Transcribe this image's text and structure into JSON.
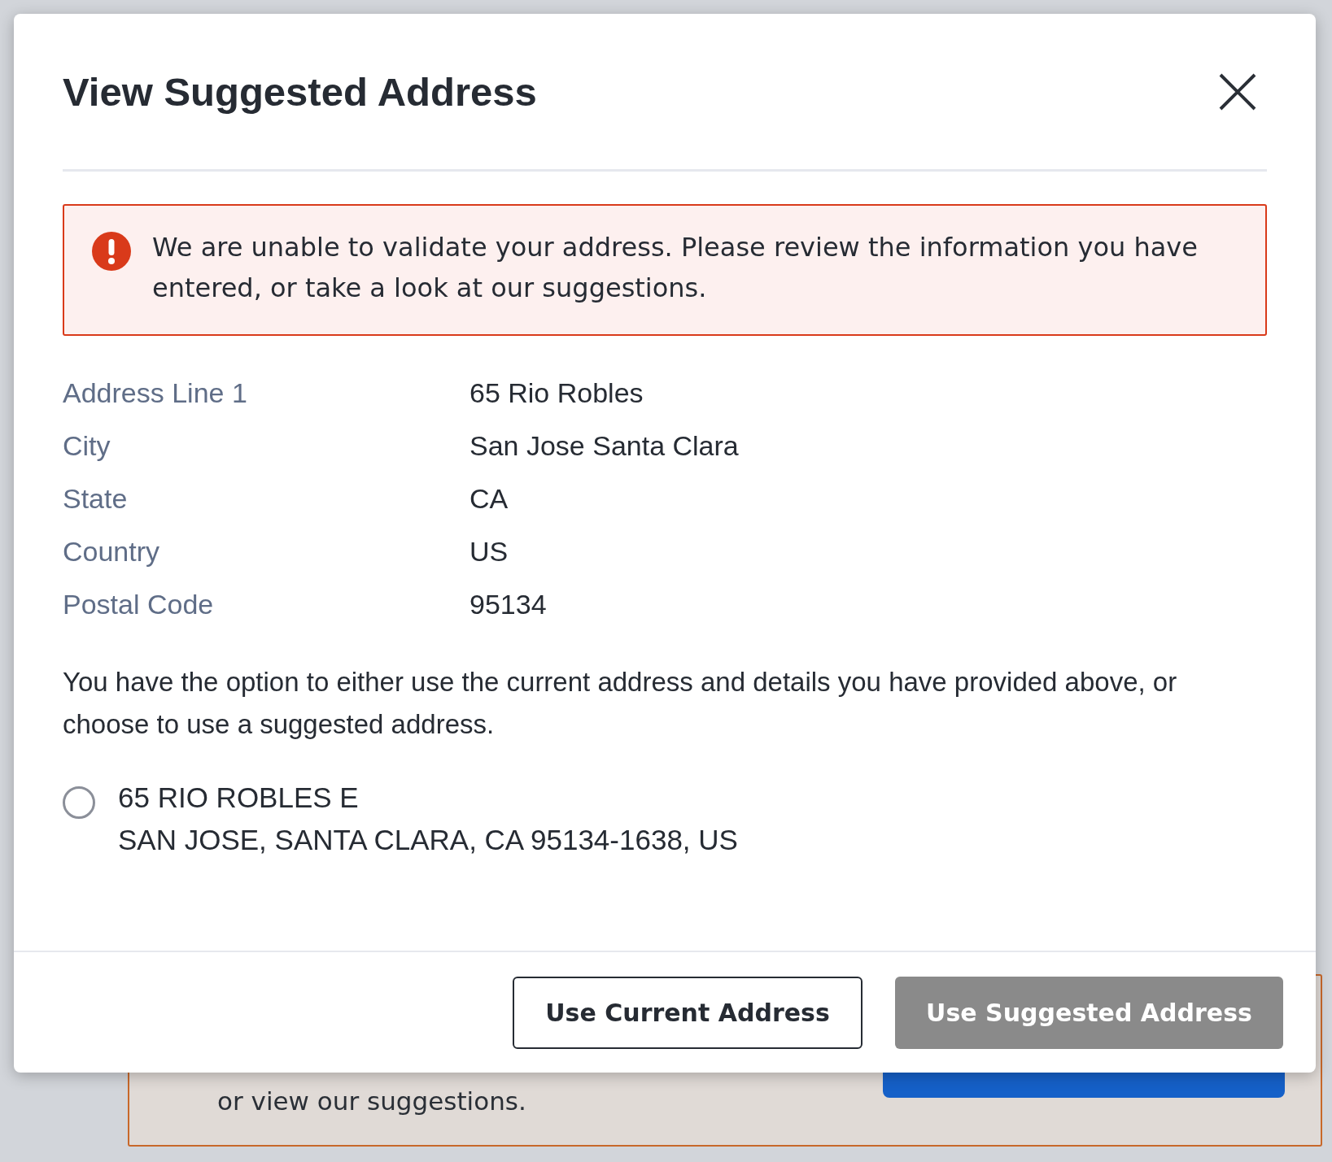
{
  "background_banner": {
    "message": "or view our suggestions.",
    "button_visible": true
  },
  "dialog": {
    "title": "View Suggested Address",
    "alert": {
      "kind": "error",
      "message": "We are unable to validate your address. Please review the information you have entered, or take a look at our suggestions."
    },
    "fields": [
      {
        "label": "Address Line 1",
        "value": "65 Rio Robles"
      },
      {
        "label": "City",
        "value": "San Jose Santa Clara"
      },
      {
        "label": "State",
        "value": "CA"
      },
      {
        "label": "Country",
        "value": "US"
      },
      {
        "label": "Postal Code",
        "value": "95134"
      }
    ],
    "instructions": "You have the option to either use the current address and details you have provided above, or choose to use a suggested address.",
    "suggestions": [
      {
        "line_1": "65 RIO ROBLES E",
        "line_2": "SAN JOSE, SANTA CLARA, CA 95134-1638, US",
        "selected": false
      }
    ],
    "buttons": [
      {
        "label": "Use Current Address",
        "kind": "secondary",
        "disabled": false
      },
      {
        "label": "Use Suggested Address",
        "kind": "primary",
        "disabled": true
      }
    ]
  }
}
